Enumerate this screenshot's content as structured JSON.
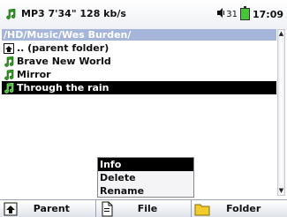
{
  "status": {
    "format_text": "MP3 7'34\" 128 kb/s",
    "volume_text": "31",
    "clock": "17:09",
    "battery_color": "#49c43a"
  },
  "path": "/HD/Music/Wes Burden/",
  "files": [
    {
      "label": ".. (parent folder)",
      "icon": "parent-folder-icon"
    },
    {
      "label": "Brave New World",
      "icon": "music-note-icon"
    },
    {
      "label": "Mirror",
      "icon": "music-note-icon"
    },
    {
      "label": "Through the rain",
      "icon": "music-note-icon",
      "selected": true
    }
  ],
  "context_menu": {
    "items": [
      {
        "label": "Info",
        "active": true
      },
      {
        "label": "Delete"
      },
      {
        "label": "Rename"
      }
    ]
  },
  "bottom_bar": {
    "parent_label": "Parent",
    "file_label": "File",
    "folder_label": "Folder"
  },
  "colors": {
    "path_bar": "#a6b6db",
    "selected_row": "#000000",
    "note_green": "#2e9a1f"
  }
}
